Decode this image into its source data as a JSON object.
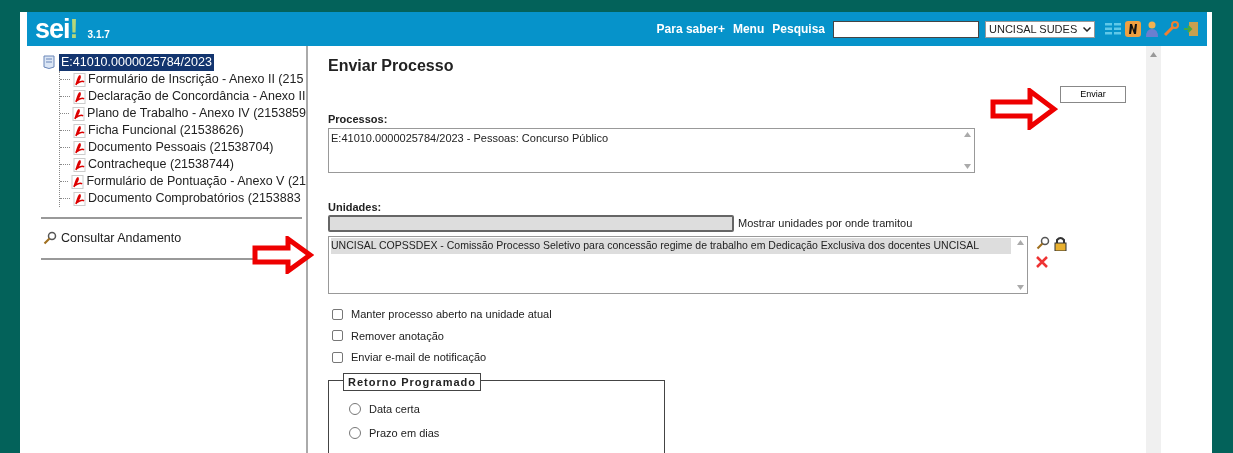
{
  "header": {
    "logo": "sei",
    "logo_mark": "!",
    "version": "3.1.7",
    "links": [
      "Para saber+",
      "Menu",
      "Pesquisa"
    ],
    "unit_select": "UNCISAL SUDES"
  },
  "tree": {
    "label": "E:41010.0000025784/2023",
    "selected": true,
    "children": [
      {
        "label": "Formulário de Inscrição - Anexo II (215",
        "selected": false
      },
      {
        "label": "Declaração de Concordância - Anexo II",
        "selected": false
      },
      {
        "label": "Plano de Trabalho - Anexo IV (2153859",
        "selected": false
      },
      {
        "label": "Ficha Funcional (21538626)",
        "selected": false
      },
      {
        "label": "Documento Pessoais (21538704)",
        "selected": false
      },
      {
        "label": "Contracheque (21538744)",
        "selected": false
      },
      {
        "label": "Formulário de Pontuação - Anexo V (21",
        "selected": false
      },
      {
        "label": "Documento Comprobatórios (2153883",
        "selected": false
      }
    ]
  },
  "side_action": "Consultar Andamento",
  "form": {
    "title": "Enviar Processo",
    "send_button": "Enviar",
    "processes_label": "Processos:",
    "processes": [
      {
        "label": "E:41010.0000025784/2023 - Pessoas: Concurso Público",
        "selected": false
      }
    ],
    "units_label": "Unidades:",
    "units_filter": {
      "disabled": true
    },
    "show_units_link": "Mostrar unidades por onde tramitou",
    "units": [
      {
        "label": "UNCISAL COPSSDEX - Comissão Processo Seletivo para concessão regime de trabalho em Dedicação Exclusiva dos docentes UNCISAL",
        "selected": true
      }
    ],
    "options": [
      {
        "label": "Manter processo aberto na unidade atual",
        "checked": false
      },
      {
        "label": "Remover anotação",
        "checked": false
      },
      {
        "label": "Enviar e-mail de notificação",
        "checked": false
      }
    ],
    "return_legend": "Retorno Programado",
    "return_options": [
      {
        "label": "Data certa",
        "selected": false
      },
      {
        "label": "Prazo em dias",
        "selected": false
      }
    ]
  }
}
